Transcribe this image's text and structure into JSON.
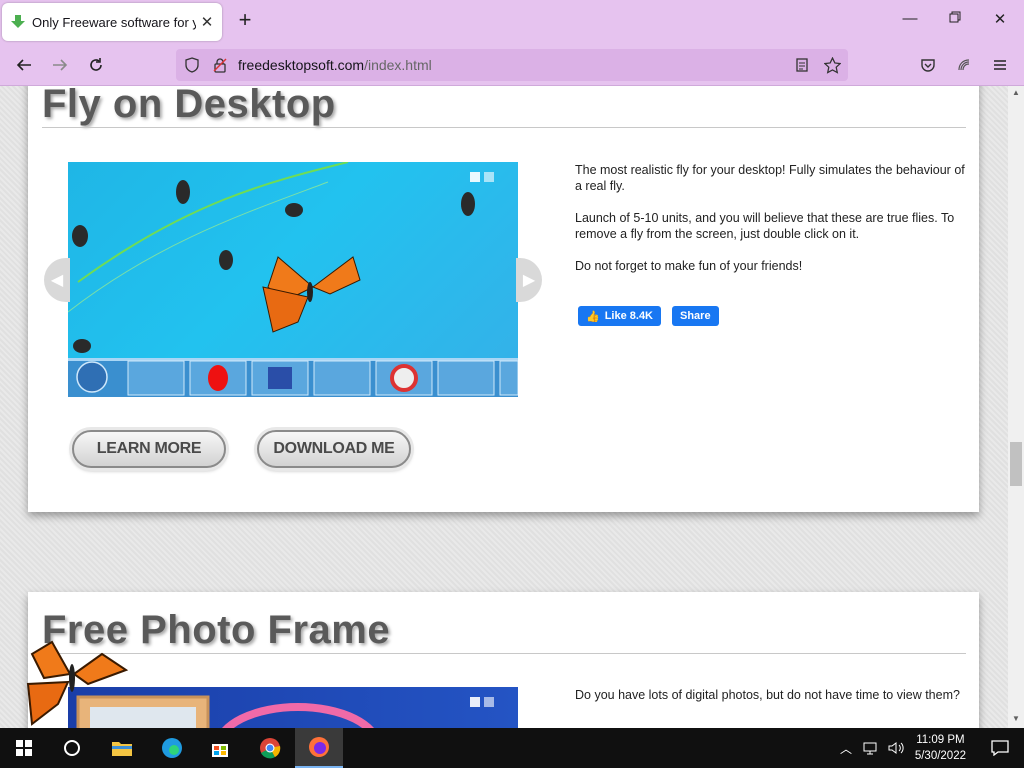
{
  "browser": {
    "tab_title": "Only Freeware software for your desktop",
    "url_domain": "freedesktopsoft.com",
    "url_path": "/index.html"
  },
  "sections": [
    {
      "title": "Fly on Desktop",
      "description": [
        "The most realistic fly for your desktop! Fully simulates the behaviour of a real fly.",
        "Launch of 5-10 units, and you will believe that these are true flies. To remove a fly from the screen, just double click on it.",
        "Do not forget to make fun of your friends!"
      ],
      "like_label": "Like 8.4K",
      "share_label": "Share",
      "learn_more": "LEARN MORE",
      "download": "DOWNLOAD ME"
    },
    {
      "title": "Free Photo Frame",
      "description": [
        "Do you have lots of digital photos, but do not have time to view them?"
      ]
    }
  ],
  "taskbar": {
    "time": "11:09 PM",
    "date": "5/30/2022"
  },
  "colors": {
    "browser_chrome": "#e6c3ef",
    "url_bar": "#dbb1e6",
    "facebook_blue": "#1877f2",
    "taskbar": "#101010"
  }
}
